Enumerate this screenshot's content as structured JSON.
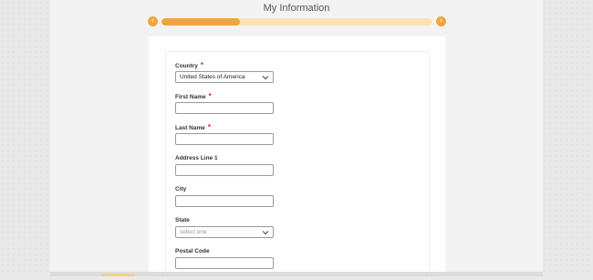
{
  "page": {
    "title": "My Information"
  },
  "progress": {
    "value": 0.29,
    "prev_glyph": "‹",
    "next_glyph": "›",
    "accent_color": "#f0a53c",
    "track_color": "#fbe3b6"
  },
  "form": {
    "country": {
      "label": "Country",
      "required": "*",
      "value": "United States of America"
    },
    "first_name": {
      "label": "First Name",
      "required": "*",
      "value": ""
    },
    "last_name": {
      "label": "Last Name",
      "required": "*",
      "value": ""
    },
    "address_line_1": {
      "label": "Address Line 1",
      "value": ""
    },
    "city": {
      "label": "City",
      "value": ""
    },
    "state": {
      "label": "State",
      "placeholder": "select one"
    },
    "postal_code": {
      "label": "Postal Code",
      "value": ""
    }
  }
}
